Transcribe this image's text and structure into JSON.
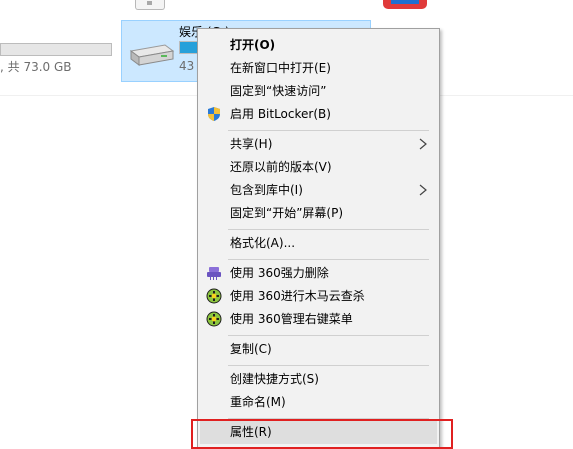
{
  "explorer": {
    "left_drive_free_text": ", 共 73.0 GB",
    "selected_drive": {
      "name": "娱乐 (G:)",
      "size_text": "43",
      "used_fraction": 0.12
    }
  },
  "context_menu": {
    "items": [
      {
        "label": "打开(O)",
        "bold": true
      },
      {
        "label": "在新窗口中打开(E)"
      },
      {
        "label": "固定到“快速访问”"
      },
      {
        "label": "启用 BitLocker(B)",
        "icon": "shield-icon"
      },
      {
        "label": "共享(H)",
        "submenu": true
      },
      {
        "label": "还原以前的版本(V)"
      },
      {
        "label": "包含到库中(I)",
        "submenu": true
      },
      {
        "label": "固定到“开始”屏幕(P)"
      },
      {
        "label": "格式化(A)..."
      },
      {
        "label": "使用 360强力删除",
        "icon": "360-shred-icon"
      },
      {
        "label": "使用 360进行木马云查杀",
        "icon": "360-scan-icon"
      },
      {
        "label": "使用 360管理右键菜单",
        "icon": "360-menu-icon"
      },
      {
        "label": "复制(C)"
      },
      {
        "label": "创建快捷方式(S)"
      },
      {
        "label": "重命名(M)"
      },
      {
        "label": "属性(R)",
        "highlighted": true
      }
    ]
  },
  "colors": {
    "menu_bg": "#f2f2f2",
    "selection_bg": "#cce8ff",
    "progress_fill": "#26a0da",
    "annotation_box": "#e02020"
  }
}
